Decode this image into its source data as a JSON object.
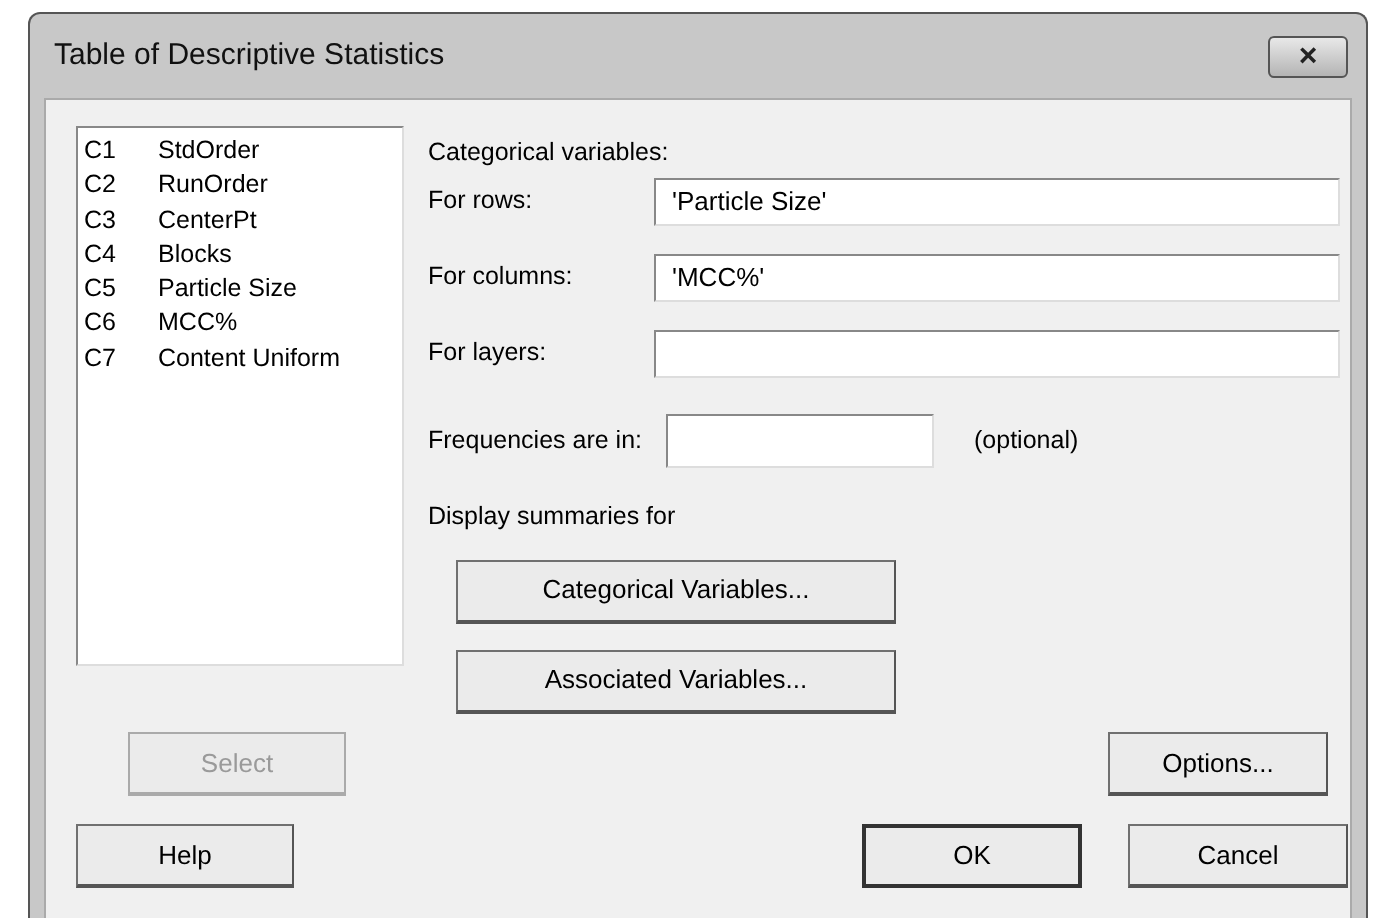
{
  "window": {
    "title": "Table of Descriptive Statistics",
    "close": "×"
  },
  "columns": [
    {
      "id": "C1",
      "name": "StdOrder"
    },
    {
      "id": "C2",
      "name": "RunOrder"
    },
    {
      "id": "C3",
      "name": "CenterPt"
    },
    {
      "id": "C4",
      "name": "Blocks"
    },
    {
      "id": "C5",
      "name": "Particle Size"
    },
    {
      "id": "C6",
      "name": "MCC%"
    },
    {
      "id": "C7",
      "name": "Content Uniform"
    }
  ],
  "categorical_heading": "Categorical variables:",
  "fields": [
    {
      "label": "For rows:",
      "value": "'Particle Size'"
    },
    {
      "label": "For columns:",
      "value": "'MCC%'"
    },
    {
      "label": "For layers:"
    }
  ],
  "frequencies": {
    "label": "Frequencies are in:",
    "note": "(optional)"
  },
  "summaries_heading": "Display summaries for",
  "summary_buttons": [
    "Categorical Variables...",
    "Associated Variables..."
  ],
  "select_button": {
    "label": "Select",
    "disabled": true
  },
  "options_button": "Options...",
  "footer_buttons": [
    {
      "label": "Help"
    },
    {
      "label": "OK",
      "default": true
    },
    {
      "label": "Cancel"
    }
  ]
}
